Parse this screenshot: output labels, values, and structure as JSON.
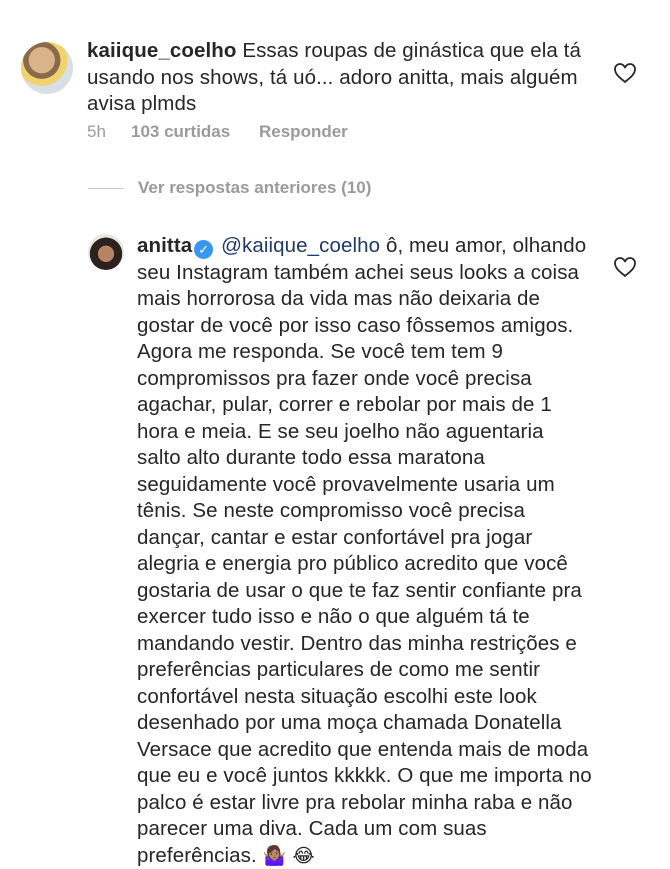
{
  "comment1": {
    "username": "kaiique_coelho",
    "text": "Essas roupas de ginástica que ela tá usando nos shows, tá uó... adoro anitta, mais alguém avisa plmds",
    "time": "5h",
    "likes": "103 curtidas",
    "reply_label": "Responder",
    "avatar_icon": "user-avatar"
  },
  "replies_toggle": {
    "label": "Ver respostas anteriores (10)"
  },
  "comment2": {
    "username": "anitta",
    "verified": true,
    "mention": "@kaiique_coelho",
    "text": "ô, meu amor, olhando seu Instagram também achei seus looks a coisa mais horrorosa da vida mas não deixaria de gostar de você por isso caso fôssemos amigos. Agora me responda. Se você tem tem 9 compromissos pra fazer onde você precisa agachar, pular, correr e rebolar por mais de 1 hora e meia. E se seu joelho não aguentaria salto alto durante todo essa maratona seguidamente você provavelmente usaria um tênis. Se neste compromisso você precisa dançar, cantar e estar confortável pra jogar alegria e energia pro público acredito que você gostaria de usar o que te faz sentir confiante pra exercer tudo isso e não o que alguém tá te mandando vestir. Dentro das minha restrições e preferências particulares de como me sentir confortável nesta situação escolhi este look desenhado por uma moça chamada Donatella Versace que acredito que entenda mais de moda que eu e você juntos kkkkk. O que me importa no palco é estar livre pra rebolar minha raba e não parecer uma diva. Cada um com suas preferências.",
    "emojis": "🤷🏽‍♀️ 😂"
  },
  "colors": {
    "text": "#262626",
    "muted": "#9a9a9a",
    "mention": "#1f3a66",
    "verified": "#3897f0"
  },
  "icons": [
    "heart-outline-icon",
    "verified-badge-icon"
  ]
}
